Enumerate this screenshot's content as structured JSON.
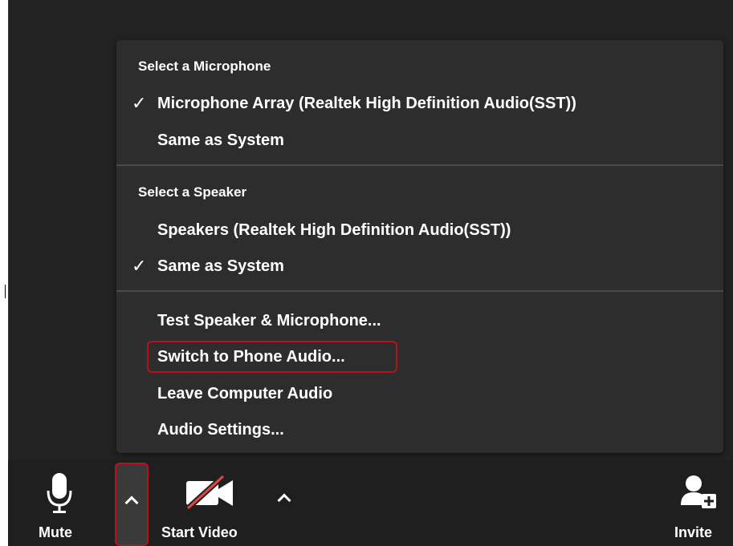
{
  "audio_menu": {
    "microphone_header": "Select a Microphone",
    "microphones": [
      {
        "label": "Microphone Array (Realtek High Definition Audio(SST))",
        "checked": true
      },
      {
        "label": "Same as System",
        "checked": false
      }
    ],
    "speaker_header": "Select a Speaker",
    "speakers": [
      {
        "label": "Speakers (Realtek High Definition Audio(SST))",
        "checked": false
      },
      {
        "label": "Same as System",
        "checked": true
      }
    ],
    "actions": [
      {
        "label": "Test Speaker & Microphone..."
      },
      {
        "label": "Switch to Phone Audio..."
      },
      {
        "label": "Leave Computer Audio"
      },
      {
        "label": "Audio Settings..."
      }
    ],
    "check_glyph": "✓"
  },
  "toolbar": {
    "mute_label": "Mute",
    "start_video_label": "Start Video",
    "invite_label": "Invite"
  },
  "colors": {
    "background": "#222222",
    "menu_bg": "#2d2d2d",
    "highlight": "#b5121b",
    "video_off_slash": "#e0463b"
  },
  "icons": {
    "mute": "microphone-icon",
    "audio_options": "chevron-up-icon",
    "start_video": "video-camera-off-icon",
    "video_options": "chevron-up-icon",
    "invite": "add-user-icon"
  }
}
